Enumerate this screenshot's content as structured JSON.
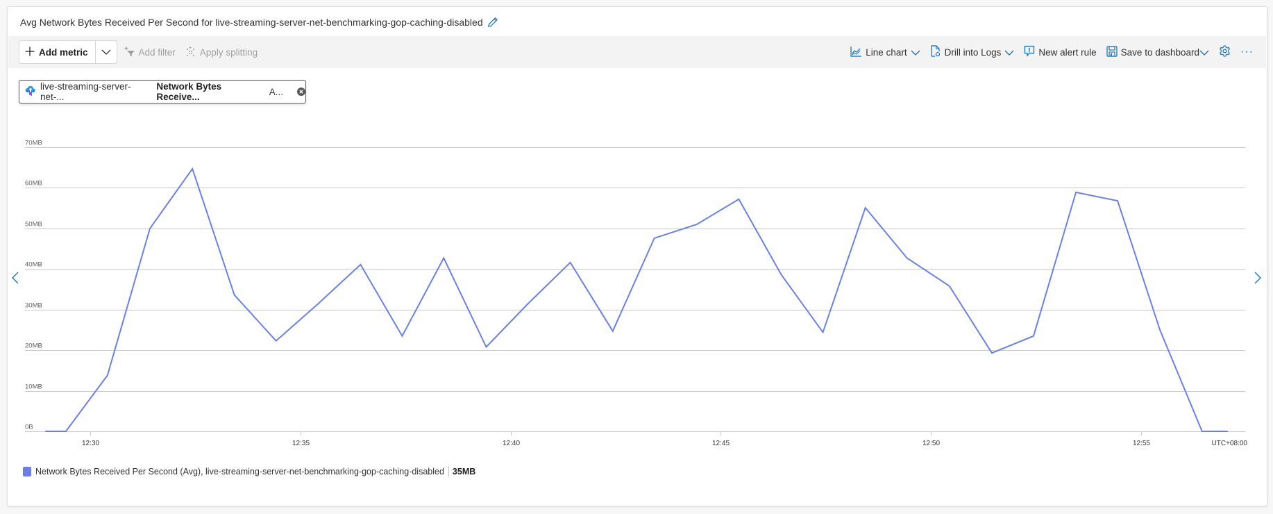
{
  "header": {
    "title": "Avg Network Bytes Received Per Second for live-streaming-server-net-benchmarking-gop-caching-disabled",
    "edit_icon": "pencil-icon"
  },
  "toolbar": {
    "add_metric_label": "Add metric",
    "add_filter_label": "Add filter",
    "apply_splitting_label": "Apply splitting",
    "line_chart_label": "Line chart",
    "drill_into_logs_label": "Drill into Logs",
    "new_alert_rule_label": "New alert rule",
    "save_to_dashboard_label": "Save to dashboard",
    "more_label": "···"
  },
  "metric_pill": {
    "resource": "live-streaming-server-net-...",
    "metric": "Network Bytes Receive...",
    "aggregation": "A..."
  },
  "legend": {
    "label": "Network Bytes Received Per Second (Avg), live-streaming-server-net-benchmarking-gop-caching-disabled",
    "value": "35MB",
    "color": "#6a80e8"
  },
  "colors": {
    "accent": "#0f6cbd",
    "series": "#6a80e8",
    "grid": "#c8c8c8"
  },
  "chart_data": {
    "type": "line",
    "title": "Avg Network Bytes Received Per Second for live-streaming-server-net-benchmarking-gop-caching-disabled",
    "xlabel": "",
    "ylabel": "",
    "timezone_label": "UTC+08:00",
    "x_unit": "minutes after 12:00",
    "x_range": [
      28.93,
      56.12
    ],
    "ylim": [
      0,
      70
    ],
    "y_unit": "MB",
    "y_ticks": [
      0,
      10,
      20,
      30,
      40,
      50,
      60,
      70
    ],
    "y_tick_labels": [
      "0B",
      "10MB",
      "20MB",
      "30MB",
      "40MB",
      "50MB",
      "60MB",
      "70MB"
    ],
    "x_ticks": [
      30,
      35,
      40,
      45,
      50,
      55
    ],
    "x_tick_labels": [
      "12:30",
      "12:35",
      "12:40",
      "12:45",
      "12:50",
      "12:55"
    ],
    "grid": true,
    "legend_position": "bottom-left",
    "series": [
      {
        "name": "Network Bytes Received Per Second (Avg), live-streaming-server-net-benchmarking-gop-caching-disabled",
        "x": [
          28.93,
          29.42,
          30.41,
          31.42,
          32.43,
          33.43,
          34.42,
          35.43,
          36.43,
          37.42,
          38.41,
          39.42,
          40.41,
          41.42,
          42.43,
          43.42,
          44.43,
          45.43,
          46.44,
          47.43,
          48.44,
          49.43,
          50.44,
          51.45,
          52.44,
          53.45,
          54.44,
          55.45,
          56.45,
          57.06
        ],
        "values": [
          0,
          0,
          13.8,
          50.0,
          64.7,
          33.6,
          22.3,
          31.5,
          41.1,
          23.5,
          42.7,
          20.8,
          31.4,
          41.6,
          24.7,
          47.6,
          51.0,
          57.2,
          38.6,
          24.4,
          55.1,
          42.7,
          35.8,
          19.3,
          23.5,
          58.9,
          56.8,
          24.9,
          0,
          0
        ]
      }
    ]
  }
}
